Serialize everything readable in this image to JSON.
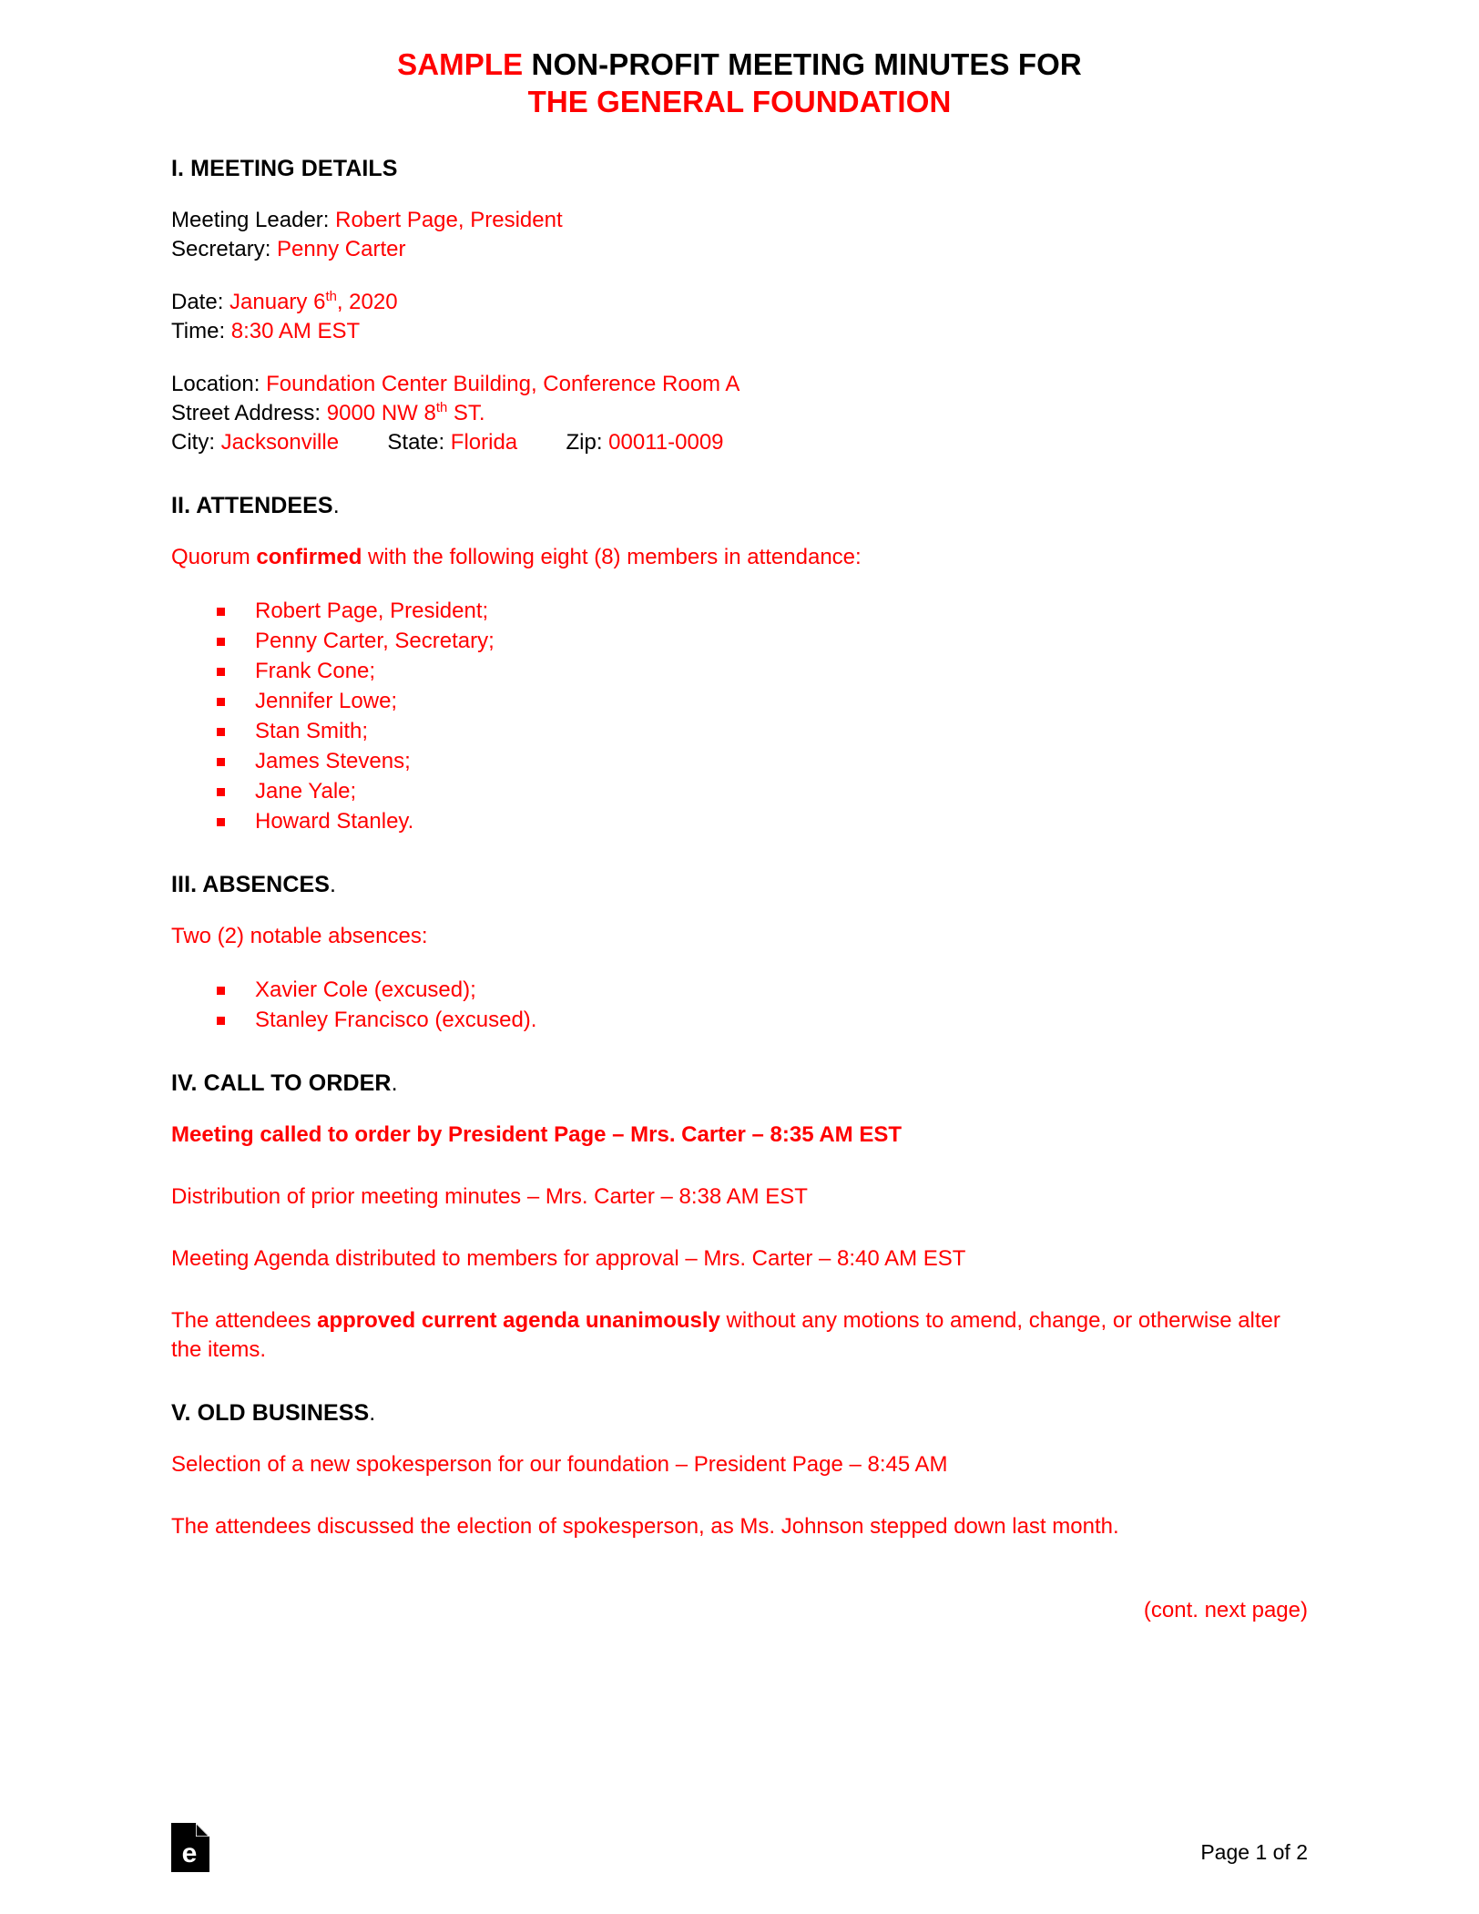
{
  "document": {
    "title_line1_highlight": "SAMPLE",
    "title_line1_rest": " NON-PROFIT MEETING MINUTES FOR",
    "title_line2": "THE GENERAL FOUNDATION",
    "accent_color": "#FF0000",
    "text_color": "#000000"
  },
  "meeting_details": {
    "heading": "I. MEETING DETAILS",
    "labels": {
      "meeting_leader": "Meeting Leader: ",
      "secretary": "Secretary: ",
      "date": "Date: ",
      "time": "Time: ",
      "location": "Location: ",
      "street_address": "Street Address: ",
      "city": "City: ",
      "state": "State: ",
      "zip": "Zip: "
    },
    "values": {
      "meeting_leader": "Robert Page, President",
      "secretary": "Penny Carter",
      "date_month_day": "January 6",
      "date_ordinal": "th",
      "date_year": ", 2020",
      "time": "8:30 AM EST",
      "location": "Foundation Center Building, Conference Room A",
      "street_number": "9000 NW 8",
      "street_ordinal": "th",
      "street_suffix": " ST.",
      "city": "Jacksonville",
      "state": "Florida",
      "zip": "00011-0009"
    }
  },
  "attendees": {
    "heading_main": "II. ATTENDEES",
    "heading_period": ".",
    "intro_pre": "Quorum ",
    "intro_bold": "confirmed",
    "intro_post": " with the following eight (8) members in attendance:",
    "items": [
      "Robert Page, President;",
      "Penny Carter, Secretary;",
      "Frank Cone;",
      "Jennifer Lowe;",
      "Stan Smith;",
      "James Stevens;",
      "Jane Yale;",
      "Howard Stanley."
    ]
  },
  "absences": {
    "heading_main": "III. ABSENCES",
    "heading_period": ".",
    "intro": "Two (2) notable absences:",
    "items": [
      "Xavier Cole (excused);",
      "Stanley Francisco (excused)."
    ]
  },
  "call_to_order": {
    "heading_main": "IV. CALL TO ORDER",
    "heading_period": ".",
    "line_called_to_order": "Meeting called to order by President Page – Mrs. Carter – 8:35 AM EST",
    "line_distribution": "Distribution of prior meeting minutes – Mrs. Carter – 8:38 AM EST",
    "line_agenda": "Meeting Agenda distributed to members for approval – Mrs. Carter – 8:40 AM EST",
    "approval_pre": "The attendees ",
    "approval_bold": "approved current agenda unanimously",
    "approval_post": " without any motions to amend, change, or otherwise alter the items."
  },
  "old_business": {
    "heading_main": "V. OLD BUSINESS",
    "heading_period": ".",
    "line_selection": "Selection of a new spokesperson for our foundation – President Page – 8:45 AM",
    "line_discussion": "The attendees discussed the election of spokesperson, as Ms. Johnson stepped down last month."
  },
  "footer": {
    "continuation_note": "(cont. next page)",
    "logo_letter": "e",
    "page_number": "Page 1 of 2"
  }
}
